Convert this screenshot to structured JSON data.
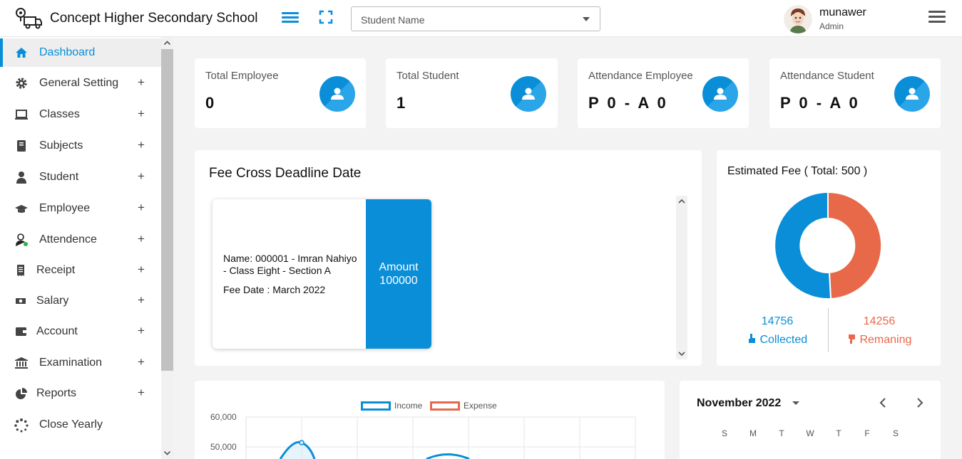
{
  "header": {
    "school_name": "Concept Higher Secondary School",
    "search_placeholder": "Student Name",
    "user_name": "munawer",
    "user_role": "Admin"
  },
  "sidebar": {
    "items": [
      {
        "label": "Dashboard",
        "icon": "home-icon",
        "active": true
      },
      {
        "label": "General Setting",
        "icon": "gear-icon",
        "expand": "+"
      },
      {
        "label": "Classes",
        "icon": "laptop-icon",
        "expand": "+"
      },
      {
        "label": "Subjects",
        "icon": "book-icon",
        "expand": "+"
      },
      {
        "label": "Student",
        "icon": "user-icon",
        "expand": "+"
      },
      {
        "label": "Employee",
        "icon": "graduation-cap-icon",
        "expand": "+"
      },
      {
        "label": "Attendence",
        "icon": "user-check-icon",
        "expand": "+"
      },
      {
        "label": "Receipt",
        "icon": "receipt-icon",
        "expand": "+"
      },
      {
        "label": "Salary",
        "icon": "money-icon",
        "expand": "+"
      },
      {
        "label": "Account",
        "icon": "wallet-icon",
        "expand": "+"
      },
      {
        "label": "Examination",
        "icon": "bank-icon",
        "expand": "+"
      },
      {
        "label": "Reports",
        "icon": "pie-chart-icon",
        "expand": "+"
      },
      {
        "label": "Close Yearly",
        "icon": "spinner-icon"
      }
    ]
  },
  "stats": [
    {
      "title": "Total Employee",
      "value": "0"
    },
    {
      "title": "Total Student",
      "value": "1"
    },
    {
      "title": "Attendance Employee",
      "value": "P 0 - A 0"
    },
    {
      "title": "Attendance Student",
      "value": "P 0 - A 0"
    }
  ],
  "fee_deadline": {
    "title": "Fee Cross Deadline Date",
    "entry": {
      "name": "Name: 000001 - Imran Nahiyo - Class Eight - Section A",
      "fee_date": "Fee Date : March 2022",
      "amount_label": "Amount",
      "amount_value": "100000"
    }
  },
  "estimated_fee": {
    "title": "Estimated Fee ( Total: 500 )",
    "collected_value": "14756",
    "collected_label": "Collected",
    "remaining_value": "14256",
    "remaining_label": "Remaning",
    "collected_color": "#0a8ed8",
    "remaining_color": "#e8694a"
  },
  "chart": {
    "legend_income": "Income",
    "legend_expense": "Expense",
    "tick_60000": "60,000",
    "tick_50000": "50,000"
  },
  "calendar": {
    "month": "November 2022",
    "weekdays": [
      "S",
      "M",
      "T",
      "W",
      "T",
      "F",
      "S"
    ]
  }
}
